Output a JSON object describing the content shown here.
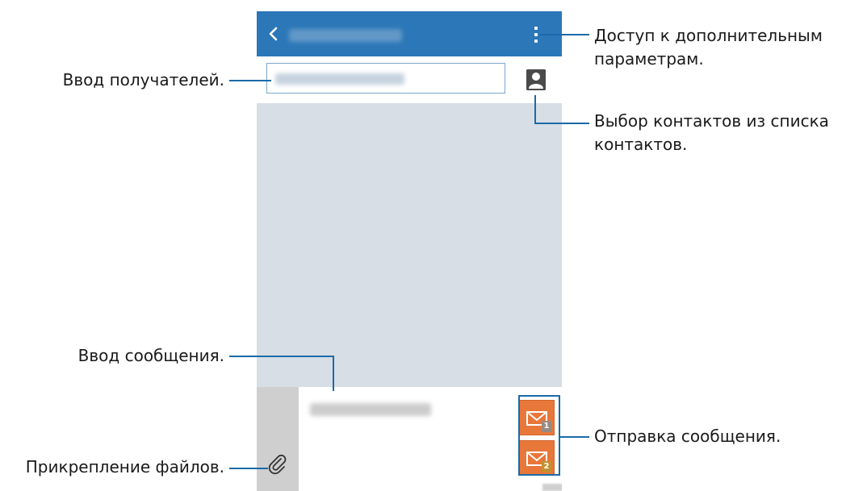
{
  "callouts": {
    "more_options": [
      "Доступ к дополнительным",
      "параметрам."
    ],
    "select_contacts": [
      "Выбор контактов из списка",
      "контактов."
    ],
    "enter_recipients": "Ввод получателей.",
    "enter_message": "Ввод сообщения.",
    "attach_files": "Прикрепление файлов.",
    "send_message": "Отправка сообщения."
  },
  "send_buttons": {
    "sim1_label": "1",
    "sim2_label": "2"
  },
  "colors": {
    "action_bar": "#2b77b8",
    "leader_line": "#1a6aa8",
    "send_button": "#e8773a",
    "background": "#d8dee5"
  },
  "icons": {
    "back": "chevron-left-icon",
    "menu": "more-vertical-icon",
    "contacts": "contact-person-icon",
    "attach": "paperclip-icon",
    "send": "envelope-icon"
  }
}
